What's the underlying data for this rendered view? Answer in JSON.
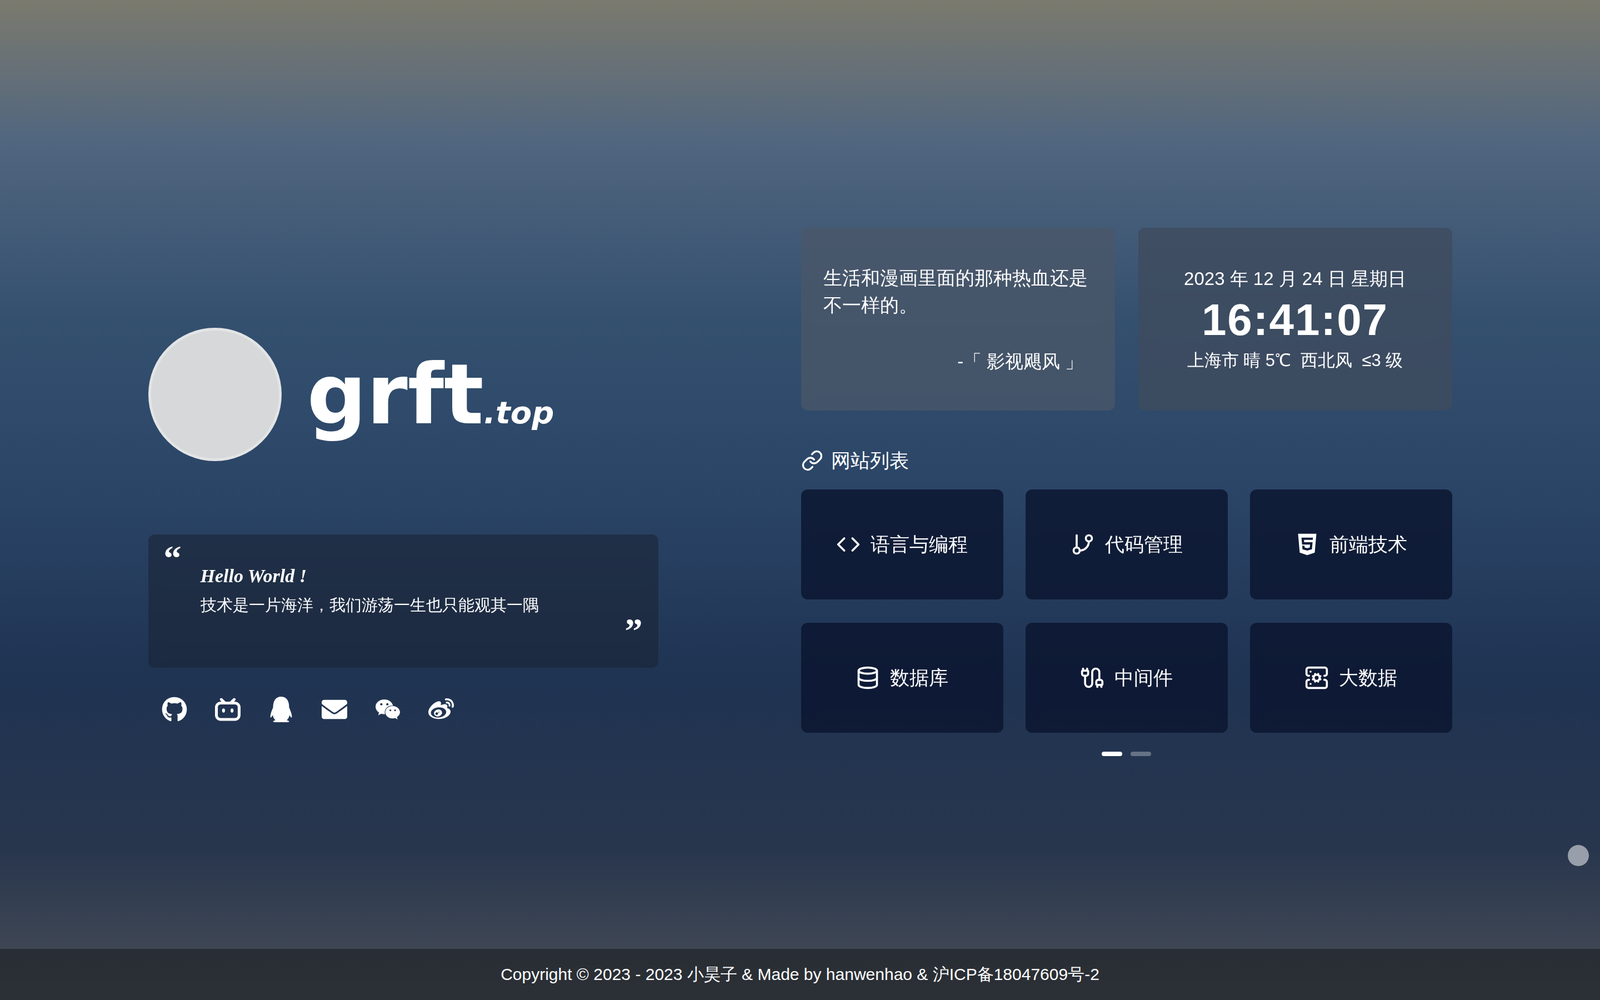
{
  "profile": {
    "logo_main": "grft",
    "logo_suffix": ".top"
  },
  "hello_card": {
    "open_quote": "“",
    "close_quote": "”",
    "title": "Hello World !",
    "text": "技术是一片海洋，我们游荡一生也只能观其一隅"
  },
  "hitokoto": {
    "text": "生活和漫画里面的那种热血还是不一样的。",
    "source": "-「 影视飓风 」"
  },
  "clock": {
    "date": "2023 年 12 月 24 日 星期日",
    "time": "16:41:07",
    "weather": "上海市 晴 5℃  西北风  ≤3 级"
  },
  "sites": {
    "title": "网站列表",
    "items": [
      {
        "label": "语言与编程"
      },
      {
        "label": "代码管理"
      },
      {
        "label": "前端技术"
      },
      {
        "label": "数据库"
      },
      {
        "label": "中间件"
      },
      {
        "label": "大数据"
      }
    ]
  },
  "pagination": [
    {
      "selected": true
    },
    {
      "selected": false
    }
  ],
  "footer": "Copyright © 2023 - 2023 小昊子 & Made by hanwenhao & 沪ICP备18047609号-2"
}
